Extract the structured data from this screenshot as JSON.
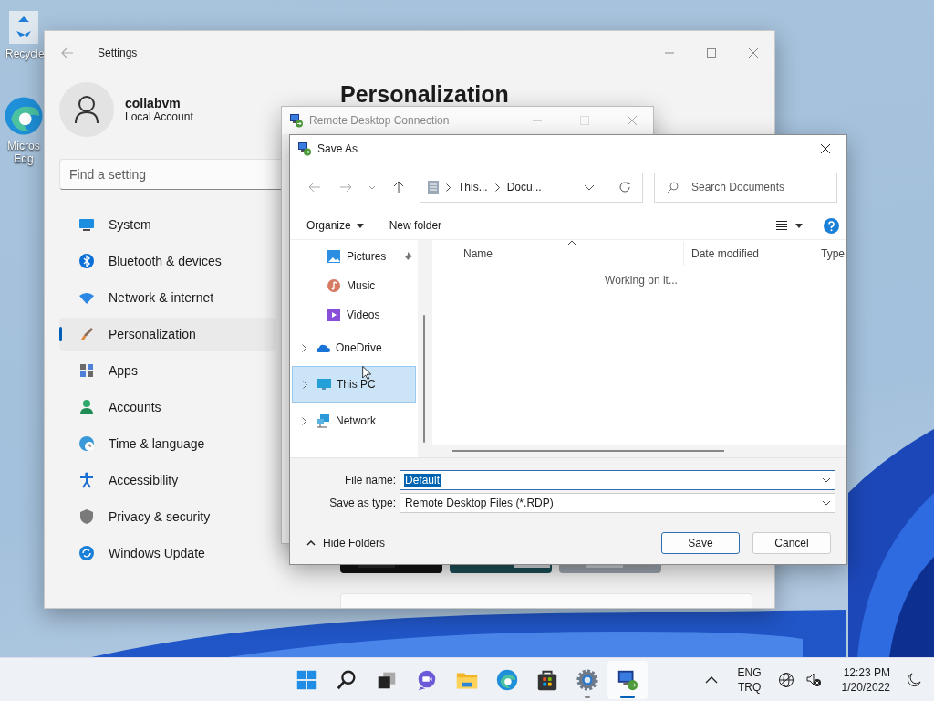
{
  "desktop": {
    "icons": [
      {
        "kind": "recycle-bin",
        "label": "Recycle"
      },
      {
        "kind": "edge",
        "label": "Micros Edg"
      }
    ]
  },
  "settings": {
    "title": "Settings",
    "user": {
      "name": "collabvm",
      "account": "Local Account"
    },
    "search": {
      "placeholder": "Find a setting"
    },
    "nav": [
      {
        "kind": "system",
        "label": "System",
        "selected": false
      },
      {
        "kind": "bluetooth",
        "label": "Bluetooth & devices",
        "selected": false
      },
      {
        "kind": "network",
        "label": "Network & internet",
        "selected": false
      },
      {
        "kind": "personalization",
        "label": "Personalization",
        "selected": true
      },
      {
        "kind": "apps",
        "label": "Apps",
        "selected": false
      },
      {
        "kind": "accounts",
        "label": "Accounts",
        "selected": false
      },
      {
        "kind": "time",
        "label": "Time & language",
        "selected": false
      },
      {
        "kind": "accessibility",
        "label": "Accessibility",
        "selected": false
      },
      {
        "kind": "privacy",
        "label": "Privacy & security",
        "selected": false
      },
      {
        "kind": "update",
        "label": "Windows Update",
        "selected": false
      }
    ],
    "heading": "Personalization"
  },
  "rdc": {
    "title": "Remote Desktop Connection"
  },
  "save_as": {
    "title": "Save As",
    "path": [
      "This...",
      "Docu..."
    ],
    "search": {
      "placeholder": "Search Documents"
    },
    "toolbar": {
      "organize": "Organize",
      "new_folder": "New folder"
    },
    "nav": [
      {
        "kind": "pictures",
        "label": "Pictures",
        "pinned": true,
        "selected": false
      },
      {
        "kind": "music",
        "label": "Music",
        "pinned": false,
        "selected": false
      },
      {
        "kind": "videos",
        "label": "Videos",
        "pinned": false,
        "selected": false
      },
      {
        "kind": "onedrive",
        "label": "OneDrive",
        "expandable": true,
        "selected": false
      },
      {
        "kind": "pc",
        "label": "This PC",
        "expandable": true,
        "selected": true
      },
      {
        "kind": "network",
        "label": "Network",
        "expandable": true,
        "selected": false
      }
    ],
    "columns": [
      "Name",
      "Date modified",
      "Type"
    ],
    "status": "Working on it...",
    "file_name": {
      "label": "File name:",
      "value": "Default",
      "value_selected": true
    },
    "save_type": {
      "label": "Save as type:",
      "value": "Remote Desktop Files (*.RDP)"
    },
    "hide_folders": "Hide Folders",
    "buttons": [
      {
        "label": "Save",
        "default": true
      },
      {
        "label": "Cancel",
        "default": false
      }
    ]
  },
  "taskbar": {
    "apps": [
      {
        "kind": "start",
        "running": false,
        "active": false
      },
      {
        "kind": "search",
        "running": false,
        "active": false
      },
      {
        "kind": "task-view",
        "running": false,
        "active": false
      },
      {
        "kind": "chat",
        "running": false,
        "active": false
      },
      {
        "kind": "explorer",
        "running": false,
        "active": false
      },
      {
        "kind": "edge",
        "running": false,
        "active": false
      },
      {
        "kind": "store",
        "running": false,
        "active": false
      },
      {
        "kind": "settings",
        "running": true,
        "active": false
      },
      {
        "kind": "remote-desktop",
        "running": true,
        "active": true
      }
    ],
    "language": [
      "ENG",
      "TRQ"
    ],
    "time": "12:23 PM",
    "date": "1/20/2022"
  }
}
